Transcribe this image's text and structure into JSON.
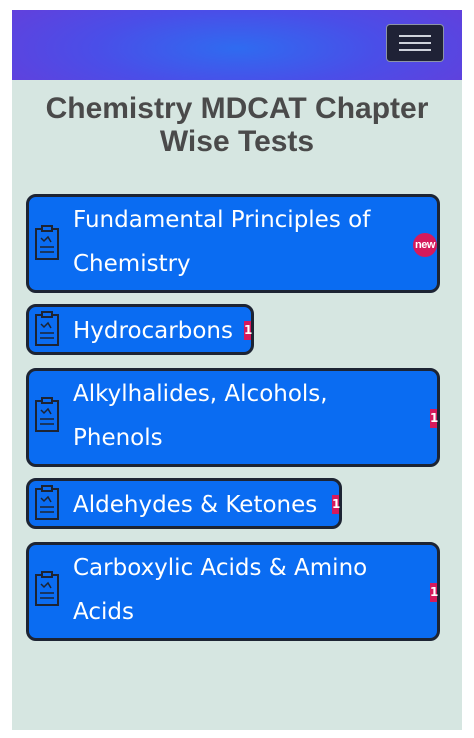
{
  "header": {
    "menu_icon": "hamburger-menu-icon"
  },
  "page": {
    "title": "Chemistry MDCAT Chapter Wise Tests"
  },
  "chapters": [
    {
      "label": "Fundamental Principles of Chemistry",
      "badge": "new",
      "icon": "document-icon"
    },
    {
      "label": "Hydrocarbons",
      "badge": "1",
      "icon": "document-icon"
    },
    {
      "label": "Alkylhalides, Alcohols, Phenols",
      "badge": "1",
      "icon": "document-icon"
    },
    {
      "label": "Aldehydes & Ketones",
      "badge": "1",
      "icon": "document-icon"
    },
    {
      "label": "Carboxylic Acids & Amino Acids",
      "badge": "1",
      "icon": "document-icon"
    }
  ],
  "colors": {
    "header_gradient": [
      "#2f6bf0",
      "#6a3bd8"
    ],
    "button_blue": "#0a6cf2",
    "badge_pink": "#d61a5c",
    "background": "#d6e6e1"
  }
}
